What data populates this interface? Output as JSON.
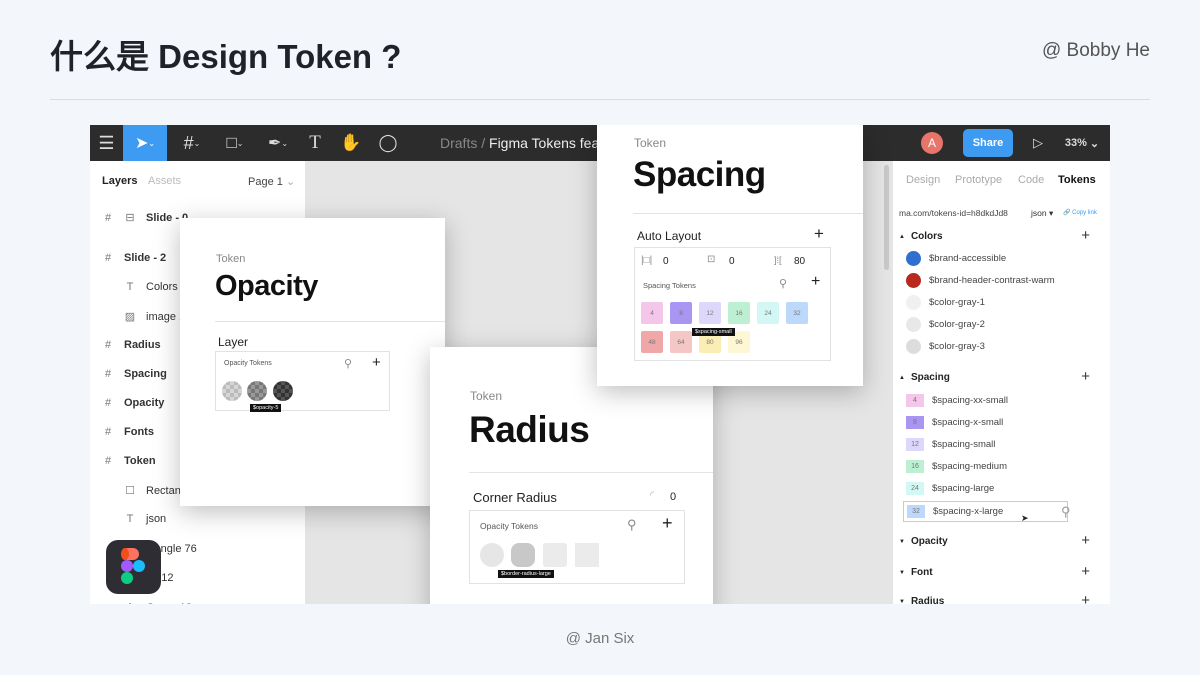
{
  "slide": {
    "title": "什么是 Design Token ?",
    "author": "@ Bobby He",
    "footer": "@ Jan Six"
  },
  "toolbar": {
    "menu_icon": "hamburger-icon",
    "tools": [
      "move-tool",
      "frame-tool",
      "shape-tool",
      "pen-tool",
      "text-tool",
      "hand-tool",
      "comment-tool"
    ],
    "breadcrumb_root": "Drafts",
    "breadcrumb_sep": "/",
    "file_name": "Figma Tokens fea",
    "avatar_letter": "A",
    "avatar_color": "#e8756a",
    "share_label": "Share",
    "share_color": "#3d9bf2",
    "zoom": "33%"
  },
  "left_panel": {
    "tab_layers": "Layers",
    "tab_assets": "Assets",
    "page": "Page 1",
    "layers": [
      {
        "label": "Slide - 0",
        "icon": "#",
        "bold": true
      },
      {
        "label": "Slide - 2",
        "icon": "#",
        "bold": true
      },
      {
        "label": "Colors",
        "icon": "T"
      },
      {
        "label": "image 1",
        "icon": "▨"
      },
      {
        "label": "Radius",
        "icon": "#",
        "bold": true
      },
      {
        "label": "Spacing",
        "icon": "#",
        "bold": true
      },
      {
        "label": "Opacity",
        "icon": "#",
        "bold": true
      },
      {
        "label": "Fonts",
        "icon": "#",
        "bold": true
      },
      {
        "label": "Token",
        "icon": "#",
        "bold": true
      },
      {
        "label": "Rectang",
        "icon": "☐"
      },
      {
        "label": "json",
        "icon": "T"
      },
      {
        "label": "ctangle 76",
        "icon": ""
      },
      {
        "label": "ge 12",
        "icon": ""
      },
      {
        "label": "Group 12",
        "icon": "⋮"
      }
    ]
  },
  "opacity_card": {
    "label": "Token",
    "title": "Opacity",
    "section": "Layer",
    "box_title": "Opacity Tokens",
    "tooltip": "$opacity-5"
  },
  "radius_card": {
    "label": "Token",
    "title": "Radius",
    "section": "Corner Radius",
    "radius_value": "0",
    "box_title": "Opacity Tokens",
    "tooltip": "$border-radius-large"
  },
  "spacing_card": {
    "label": "Token",
    "title": "Spacing",
    "section": "Auto Layout",
    "padding_h": "0",
    "padding_v": "0",
    "gap": "80",
    "box_title": "Spacing Tokens",
    "tooltip": "$spacing-small",
    "tokens": [
      {
        "v": "4",
        "c": "#f3c6ea"
      },
      {
        "v": "8",
        "c": "#a995f2"
      },
      {
        "v": "12",
        "c": "#ddd8fb"
      },
      {
        "v": "16",
        "c": "#bdf0d3"
      },
      {
        "v": "24",
        "c": "#d3f7f4"
      },
      {
        "v": "32",
        "c": "#bcd8fb"
      },
      {
        "v": "48",
        "c": "#f0a7a7"
      },
      {
        "v": "64",
        "c": "#f5c6c6"
      },
      {
        "v": "80",
        "c": "#fbeeb4"
      },
      {
        "v": "96",
        "c": "#fdf8d3"
      }
    ]
  },
  "right_panel": {
    "tabs": [
      "Design",
      "Prototype",
      "Code",
      "Tokens"
    ],
    "active_tab": "Tokens",
    "url": "ma.com/tokens-id=h8dkdJd8",
    "format": "json ▾",
    "copy_link": "Copy link",
    "colors_title": "Colors",
    "colors": [
      {
        "name": "$brand-accessible",
        "c": "#2f6fcf"
      },
      {
        "name": "$brand-header-contrast-warm",
        "c": "#b8281e"
      },
      {
        "name": "$color-gray-1",
        "c": "#f0f0f0"
      },
      {
        "name": "$color-gray-2",
        "c": "#e8e8e8"
      },
      {
        "name": "$color-gray-3",
        "c": "#dcdcdc"
      }
    ],
    "spacing_title": "Spacing",
    "spacing": [
      {
        "v": "4",
        "name": "$spacing-xx-small",
        "c": "#f3c6ea"
      },
      {
        "v": "8",
        "name": "$spacing-x-small",
        "c": "#a995f2"
      },
      {
        "v": "12",
        "name": "$spacing-small",
        "c": "#ddd8fb"
      },
      {
        "v": "16",
        "name": "$spacing-medium",
        "c": "#bdf0d3"
      },
      {
        "v": "24",
        "name": "$spacing-large",
        "c": "#d3f7f4"
      },
      {
        "v": "32",
        "name": "$spacing-x-large",
        "c": "#bcd8fb"
      }
    ],
    "opacity_title": "Opacity",
    "font_title": "Font",
    "radius_title": "Radius"
  }
}
